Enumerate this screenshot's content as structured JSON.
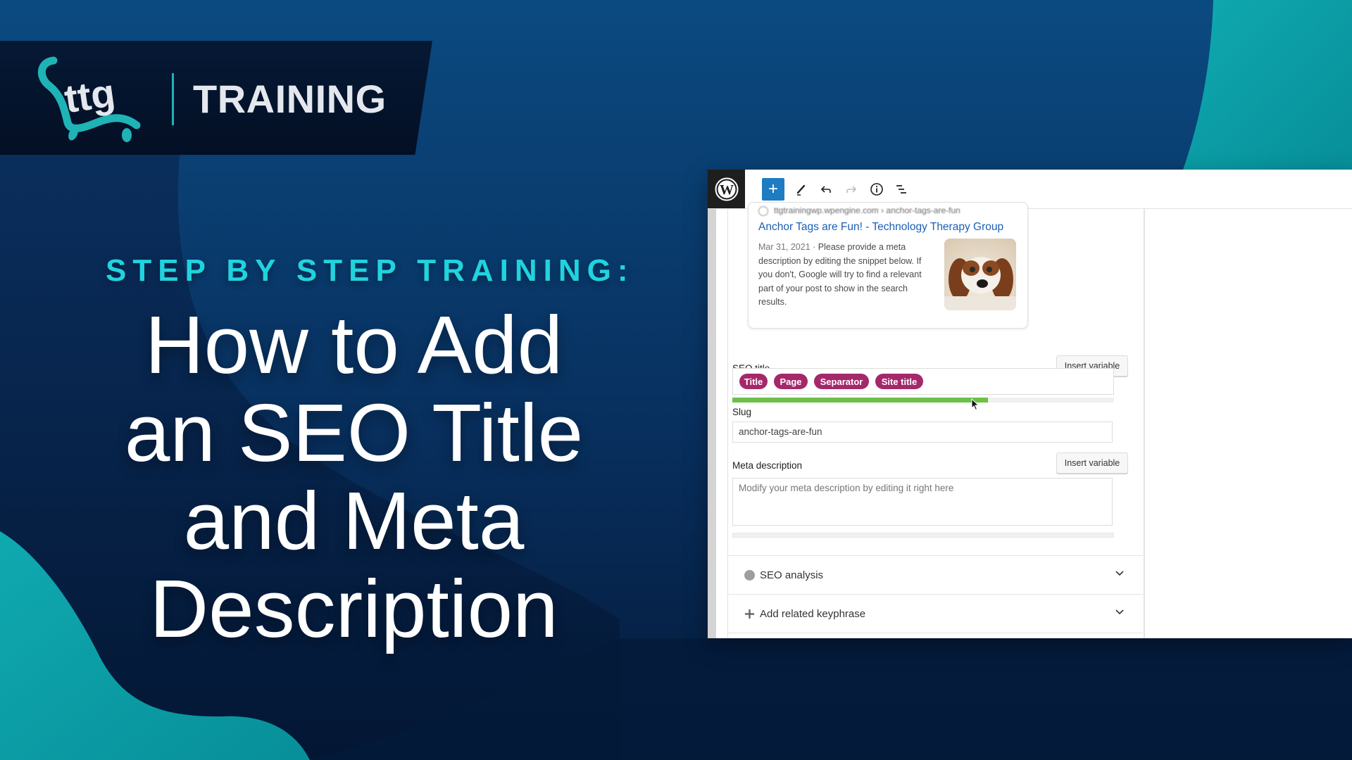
{
  "branding": {
    "logo_text": "ttg",
    "label": "TRAINING",
    "accent_color": "#20d3df",
    "teal_color": "#1fb3b6"
  },
  "hero": {
    "kicker": "STEP BY STEP TRAINING:",
    "headline_lines": [
      "How to Add",
      "an SEO Title",
      "and Meta",
      "Description"
    ]
  },
  "editor": {
    "toolbar": {
      "logo": "wordpress-logo",
      "add_label": "+",
      "icons": [
        "plus-icon",
        "pencil-icon",
        "undo-icon",
        "redo-icon",
        "info-icon",
        "list-view-icon"
      ]
    },
    "snippet_preview": {
      "url": "ttgtrainingwp.wpengine.com › anchor-tags-are-fun",
      "title": "Anchor Tags are Fun! - Technology Therapy Group",
      "date": "Mar 31, 2021",
      "separator": " · ",
      "description": "Please provide a meta description by editing the snippet below. If you don't, Google will try to find a relevant part of your post to show in the search results.",
      "image_alt": "dog-photo"
    },
    "seo_title": {
      "label": "SEO title",
      "insert_variable_label": "Insert variable",
      "variables": [
        "Title",
        "Page",
        "Separator",
        "Site title"
      ],
      "length_progress": 0.67,
      "progress_color": "#6bc047",
      "pill_color": "#a4286a"
    },
    "slug": {
      "label": "Slug",
      "value": "anchor-tags-are-fun"
    },
    "meta_description": {
      "label": "Meta description",
      "insert_variable_label": "Insert variable",
      "placeholder": "Modify your meta description by editing it right here",
      "value": "",
      "length_progress": 0
    },
    "sections": [
      {
        "label": "SEO analysis",
        "icon": "status-dot-icon"
      },
      {
        "label": "Add related keyphrase",
        "icon": "plus-icon"
      }
    ]
  }
}
